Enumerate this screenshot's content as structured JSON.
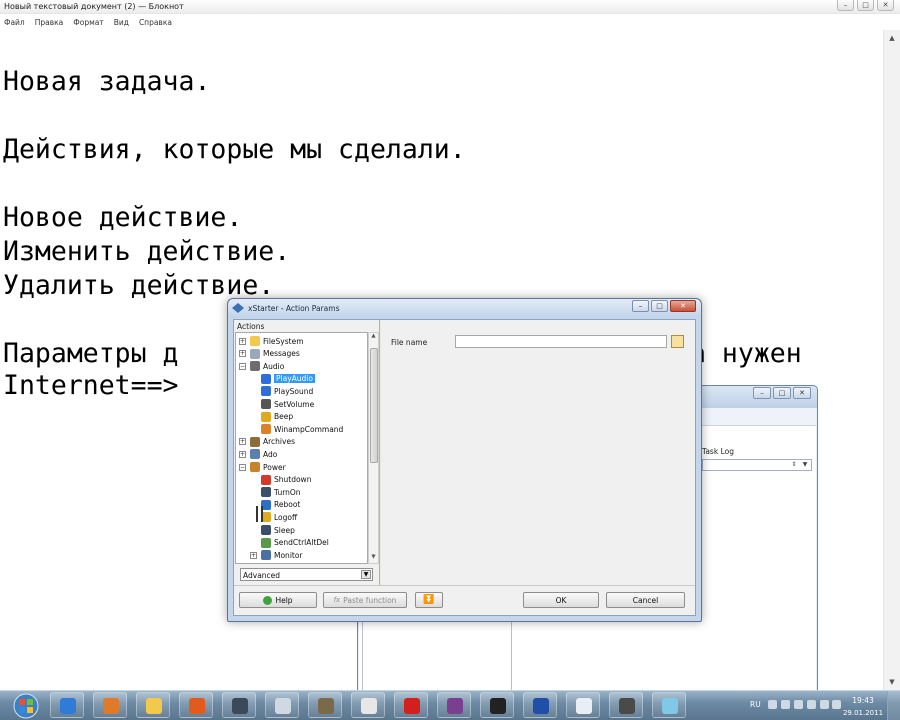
{
  "notepad": {
    "title": "Новый текстовый документ (2) — Блокнот",
    "menu": [
      "Файл",
      "Правка",
      "Формат",
      "Вид",
      "Справка"
    ],
    "lines": [
      "Новая задача.",
      "",
      "Действия, которые мы сделали.",
      "",
      "Новое действие.",
      "Изменить действие.",
      "Удалить действие.",
      "",
      "Параметры д",
      "Internet==>"
    ],
    "line_tail": "а нужен",
    "window_controls": [
      "–",
      "□",
      "✕"
    ]
  },
  "background_window": {
    "label": "Task Log"
  },
  "dialog": {
    "title": "xStarter - Action Params",
    "actions_header": "Actions",
    "tree": [
      {
        "label": "FileSystem",
        "level": 0,
        "expander": "+",
        "icon": "folder-icon",
        "color": "#f2c94c"
      },
      {
        "label": "Messages",
        "level": 0,
        "expander": "+",
        "icon": "messages-icon",
        "color": "#9aa8b8"
      },
      {
        "label": "Audio",
        "level": 0,
        "expander": "−",
        "icon": "speaker-icon",
        "color": "#6d6d6d"
      },
      {
        "label": "PlayAudio",
        "level": 1,
        "icon": "music-note-icon",
        "color": "#2d6fd6",
        "selected": true
      },
      {
        "label": "PlaySound",
        "level": 1,
        "icon": "music-note-icon",
        "color": "#2d6fd6"
      },
      {
        "label": "SetVolume",
        "level": 1,
        "icon": "volume-icon",
        "color": "#555555"
      },
      {
        "label": "Beep",
        "level": 1,
        "icon": "bell-icon",
        "color": "#e0a920"
      },
      {
        "label": "WinampCommand",
        "level": 1,
        "icon": "winamp-icon",
        "color": "#d9822b"
      },
      {
        "label": "Archives",
        "level": 0,
        "expander": "+",
        "icon": "archive-icon",
        "color": "#8a6d3b"
      },
      {
        "label": "Ado",
        "level": 0,
        "expander": "+",
        "icon": "database-icon",
        "color": "#5b7fb0"
      },
      {
        "label": "Power",
        "level": 0,
        "expander": "−",
        "icon": "power-icon",
        "color": "#c9822b"
      },
      {
        "label": "Shutdown",
        "level": 1,
        "icon": "shutdown-icon",
        "color": "#d23b2b"
      },
      {
        "label": "TurnOn",
        "level": 1,
        "icon": "computer-icon",
        "color": "#3b4f6b"
      },
      {
        "label": "Reboot",
        "level": 1,
        "icon": "reboot-icon",
        "color": "#2b6fc9"
      },
      {
        "label": "Logoff",
        "level": 1,
        "icon": "logoff-icon",
        "color": "#e0a920"
      },
      {
        "label": "Sleep",
        "level": 1,
        "icon": "computer-icon",
        "color": "#3b4f6b"
      },
      {
        "label": "SendCtrlAltDel",
        "level": 1,
        "icon": "keys-icon",
        "color": "#5a9a4a"
      },
      {
        "label": "Monitor",
        "level": 1,
        "expander": "+",
        "icon": "monitor-icon",
        "color": "#4a6fa5"
      }
    ],
    "mode_select": "Advanced",
    "file_name_label": "File name",
    "file_name_value": "",
    "buttons": {
      "help": "Help",
      "paste_function": "Paste function",
      "ok": "OK",
      "cancel": "Cancel"
    }
  },
  "taskbar": {
    "apps": [
      {
        "name": "ie-icon",
        "color": "#2f7bd6"
      },
      {
        "name": "media-player-icon",
        "color": "#e07a2b"
      },
      {
        "name": "explorer-icon",
        "color": "#f2c94c"
      },
      {
        "name": "firefox-icon",
        "color": "#e25a1c"
      },
      {
        "name": "gear-icon",
        "color": "#3a4a5a"
      },
      {
        "name": "paper-plane-icon",
        "color": "#cfd8e3"
      },
      {
        "name": "tool-icon",
        "color": "#7a6a4a"
      },
      {
        "name": "document-icon",
        "color": "#e7e7e7"
      },
      {
        "name": "opera-icon",
        "color": "#d4201d"
      },
      {
        "name": "winrar-icon",
        "color": "#7b3f8f"
      },
      {
        "name": "scorpion-icon",
        "color": "#222222"
      },
      {
        "name": "app-blue-icon",
        "color": "#1f4fa8"
      },
      {
        "name": "window-icon",
        "color": "#e9eef4"
      },
      {
        "name": "scanner-icon",
        "color": "#4a4a4a"
      },
      {
        "name": "notepad-icon",
        "color": "#7fc8e8"
      }
    ],
    "lang": "RU",
    "time": "19:43",
    "date": "29.01.2011"
  }
}
